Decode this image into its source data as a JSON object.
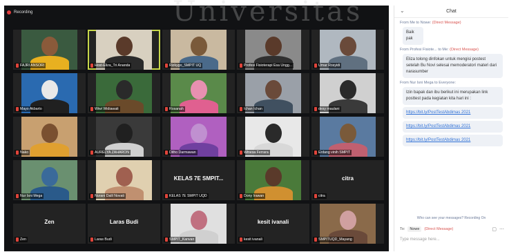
{
  "recording": {
    "label": "Recording"
  },
  "watermark": "Universitas",
  "participants": [
    {
      "name": "FAJRI ANSORI",
      "label": "",
      "bg": "#3a5a40",
      "head": "#8a5a3a",
      "shirt": "#e8b020",
      "active": false
    },
    {
      "name": "Host-Eliza_Tri Ananda",
      "label": "",
      "bg": "#d8d0c0",
      "head": "#5a3a2a",
      "shirt": "#2a2a2a",
      "active": true
    },
    {
      "name": "Rizkygo_SMPIT UQ",
      "label": "",
      "bg": "#c9b9a0",
      "head": "#7a5a3a",
      "shirt": "#4a6a8a",
      "active": false
    },
    {
      "name": "Profesi Fisioterapi Esa Ungg...",
      "label": "",
      "bg": "#8a8a8a",
      "head": "#5a3a2a",
      "shirt": "#303030",
      "active": false
    },
    {
      "name": "Umar Rosyidi",
      "label": "",
      "bg": "#b0b8c0",
      "head": "#6a4a3a",
      "shirt": "#607080",
      "active": false
    },
    {
      "name": "Mayo Akbarto",
      "label": "",
      "bg": "#2a6ab0",
      "head": "#e8e8e8",
      "shirt": "#202020",
      "active": false
    },
    {
      "name": "Wiwi Widiawati",
      "label": "",
      "bg": "#3a6a3a",
      "head": "#2a2a2a",
      "shirt": "#6a4a2a",
      "active": false
    },
    {
      "name": "Rosanah",
      "label": "",
      "bg": "#5a8a4a",
      "head": "#e890b0",
      "shirt": "#e06090",
      "active": false
    },
    {
      "name": "Ichan Ichan",
      "label": "",
      "bg": "#9aa0a8",
      "head": "#6a4a3a",
      "shirt": "#405060",
      "active": false
    },
    {
      "name": "desy maulani",
      "label": "",
      "bg": "#d0d0d0",
      "head": "#2a2a2a",
      "shirt": "#3a3a3a",
      "active": false
    },
    {
      "name": "Nako",
      "label": "",
      "bg": "#c8a070",
      "head": "#7a5030",
      "shirt": "#e0a030",
      "active": false
    },
    {
      "name": "AURELYA ZAHARON",
      "label": "",
      "bg": "#3a3a3a",
      "head": "#202020",
      "shirt": "#d0d0d0",
      "active": false
    },
    {
      "name": "Ditho Darmawan",
      "label": "",
      "bg": "#b060c0",
      "head": "#c090d0",
      "shirt": "#7040a0",
      "active": false
    },
    {
      "name": "Winesa Ferrara",
      "label": "",
      "bg": "#e8e8e8",
      "head": "#2a2a2a",
      "shirt": "#d8d8d8",
      "active": false
    },
    {
      "name": "Erdang vinih SMPIT",
      "label": "",
      "bg": "#5a7aa0",
      "head": "#7a5a3a",
      "shirt": "#c06070",
      "active": false
    },
    {
      "name": "Nur Isni Mega",
      "label": "",
      "bg": "#6a9070",
      "head": "#3a6a9a",
      "shirt": "#2a5a8a",
      "active": false
    },
    {
      "name": "Nurani Dalil Novati",
      "label": "",
      "bg": "#e0d0b0",
      "head": "#a06050",
      "shirt": "#c09070",
      "active": false
    },
    {
      "name": "KELAS 7E SMPIT UQD",
      "label": "KELAS 7E SMPIT...",
      "bg": "",
      "head": "",
      "shirt": "",
      "active": false
    },
    {
      "name": "Dony Irawan",
      "label": "",
      "bg": "#4a7a3a",
      "head": "#5a3a2a",
      "shirt": "#d09030",
      "active": false
    },
    {
      "name": "citra",
      "label": "citra",
      "bg": "",
      "head": "",
      "shirt": "",
      "active": false
    },
    {
      "name": "Zen",
      "label": "Zen",
      "bg": "",
      "head": "",
      "shirt": "",
      "active": false
    },
    {
      "name": "Laras Budi",
      "label": "Laras Budi",
      "bg": "",
      "head": "",
      "shirt": "",
      "active": false
    },
    {
      "name": "SMPIT_Kanvan",
      "label": "",
      "bg": "#e0e0e0",
      "head": "#c07080",
      "shirt": "#d0d0d0",
      "active": false
    },
    {
      "name": "kesit ivanali",
      "label": "kesit ivanali",
      "bg": "",
      "head": "",
      "shirt": "",
      "active": false
    },
    {
      "name": "SMPITUQD_Mayang",
      "label": "",
      "bg": "#8a6a4a",
      "head": "#d0a0a0",
      "shirt": "#6a4a3a",
      "active": false
    }
  ],
  "chat": {
    "title": "Chat",
    "collapse_icon": "chevron-down-icon",
    "from1": "From Me to Nowe:",
    "from1_dm": "(Direct Message)",
    "msg1": "Baik pak",
    "from2": "From Profesi Fisiote... to Me:",
    "from2_dm": "(Direct Message)",
    "msg2": "Eliza tolong dinfokan untuk mengisi postest setelah Bu Novi selesai memoderatori materi dari narasumber",
    "from3": "From Nur Isni Mega to Everyone:",
    "msg3": "Izin bapak dan ibu berikut ini merupakan link posttest pada kegiatan kita hari ini :",
    "link1": "https://bit.ly/PostTestAbdimas 2021",
    "link2": "https://bit.ly/PostTestAbdimas 2021",
    "link3": "https://bit.ly/PostTestAbdimas 2021",
    "privacy": "Who can see your messages? Recording On",
    "to_label": "To:",
    "to_value": "Nowe",
    "to_dm": "(Direct Message)",
    "input_placeholder": "Type message here..."
  }
}
